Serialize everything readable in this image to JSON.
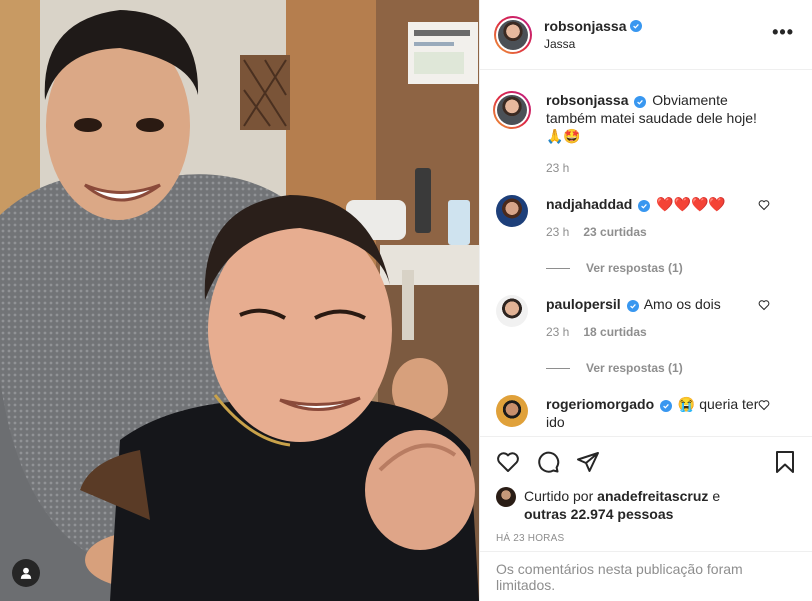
{
  "post": {
    "author": "robsonjassa",
    "location": "Jassa",
    "more_glyph": "•••"
  },
  "caption": {
    "username": "robsonjassa",
    "text": "Obviamente também matei saudade dele hoje! 🙏🤩",
    "time": "23 h"
  },
  "comments": [
    {
      "username": "nadjahaddad",
      "verified": true,
      "text": "❤️❤️❤️❤️",
      "time": "23 h",
      "likes": "23 curtidas",
      "replies": "Ver respostas (1)"
    },
    {
      "username": "paulopersil",
      "verified": true,
      "text": "Amo os dois",
      "time": "23 h",
      "likes": "18 curtidas",
      "replies": "Ver respostas (1)"
    },
    {
      "username": "rogeriomorgado",
      "verified": true,
      "text": "😭 queria ter ido"
    }
  ],
  "likes": {
    "prefix": "Curtido por",
    "user": "anadefreitascruz",
    "conj": "e",
    "others": "outras 22.974 pessoas"
  },
  "timestamp": "HÁ 23 HORAS",
  "comments_limited": "Os comentários nesta publicação foram limitados.",
  "icons": {
    "like": "heart-outline-icon",
    "comment": "comment-icon",
    "share": "paper-plane-icon",
    "save": "bookmark-icon",
    "tagged": "user-tag-icon"
  },
  "colors": {
    "verified": "#3897f0",
    "muted": "#8e8e8e",
    "text": "#262626",
    "heart": "#ed4956"
  }
}
